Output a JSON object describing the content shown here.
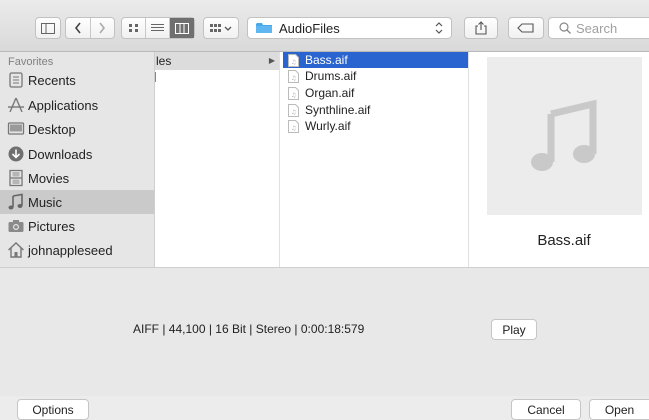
{
  "toolbar": {
    "path_label": "AudioFiles",
    "search_placeholder": "Search"
  },
  "sidebar": {
    "heading": "Favorites",
    "items": [
      {
        "label": "Recents",
        "icon": "clock-icon",
        "selected": false
      },
      {
        "label": "Applications",
        "icon": "applications-icon",
        "selected": false
      },
      {
        "label": "Desktop",
        "icon": "desktop-icon",
        "selected": false
      },
      {
        "label": "Downloads",
        "icon": "downloads-icon",
        "selected": false
      },
      {
        "label": "Movies",
        "icon": "film-icon",
        "selected": false
      },
      {
        "label": "Music",
        "icon": "music-note-icon",
        "selected": true
      },
      {
        "label": "Pictures",
        "icon": "camera-icon",
        "selected": false
      },
      {
        "label": "johnappleseed",
        "icon": "home-icon",
        "selected": false
      }
    ]
  },
  "columns": {
    "parent_partial": "les",
    "files": [
      {
        "name": "Bass.aif",
        "selected": true
      },
      {
        "name": "Drums.aif",
        "selected": false
      },
      {
        "name": "Organ.aif",
        "selected": false
      },
      {
        "name": "Synthline.aif",
        "selected": false
      },
      {
        "name": "Wurly.aif",
        "selected": false
      }
    ]
  },
  "preview": {
    "filename": "Bass.aif"
  },
  "info": {
    "metadata": "AIFF  |  44,100  |  16 Bit  |  Stereo  |  0:00:18:579",
    "play_label": "Play"
  },
  "footer": {
    "options_label": "Options",
    "cancel_label": "Cancel",
    "open_label": "Open"
  },
  "colors": {
    "selection_blue": "#2a64d0",
    "sidebar_selection": "#cacaca"
  }
}
